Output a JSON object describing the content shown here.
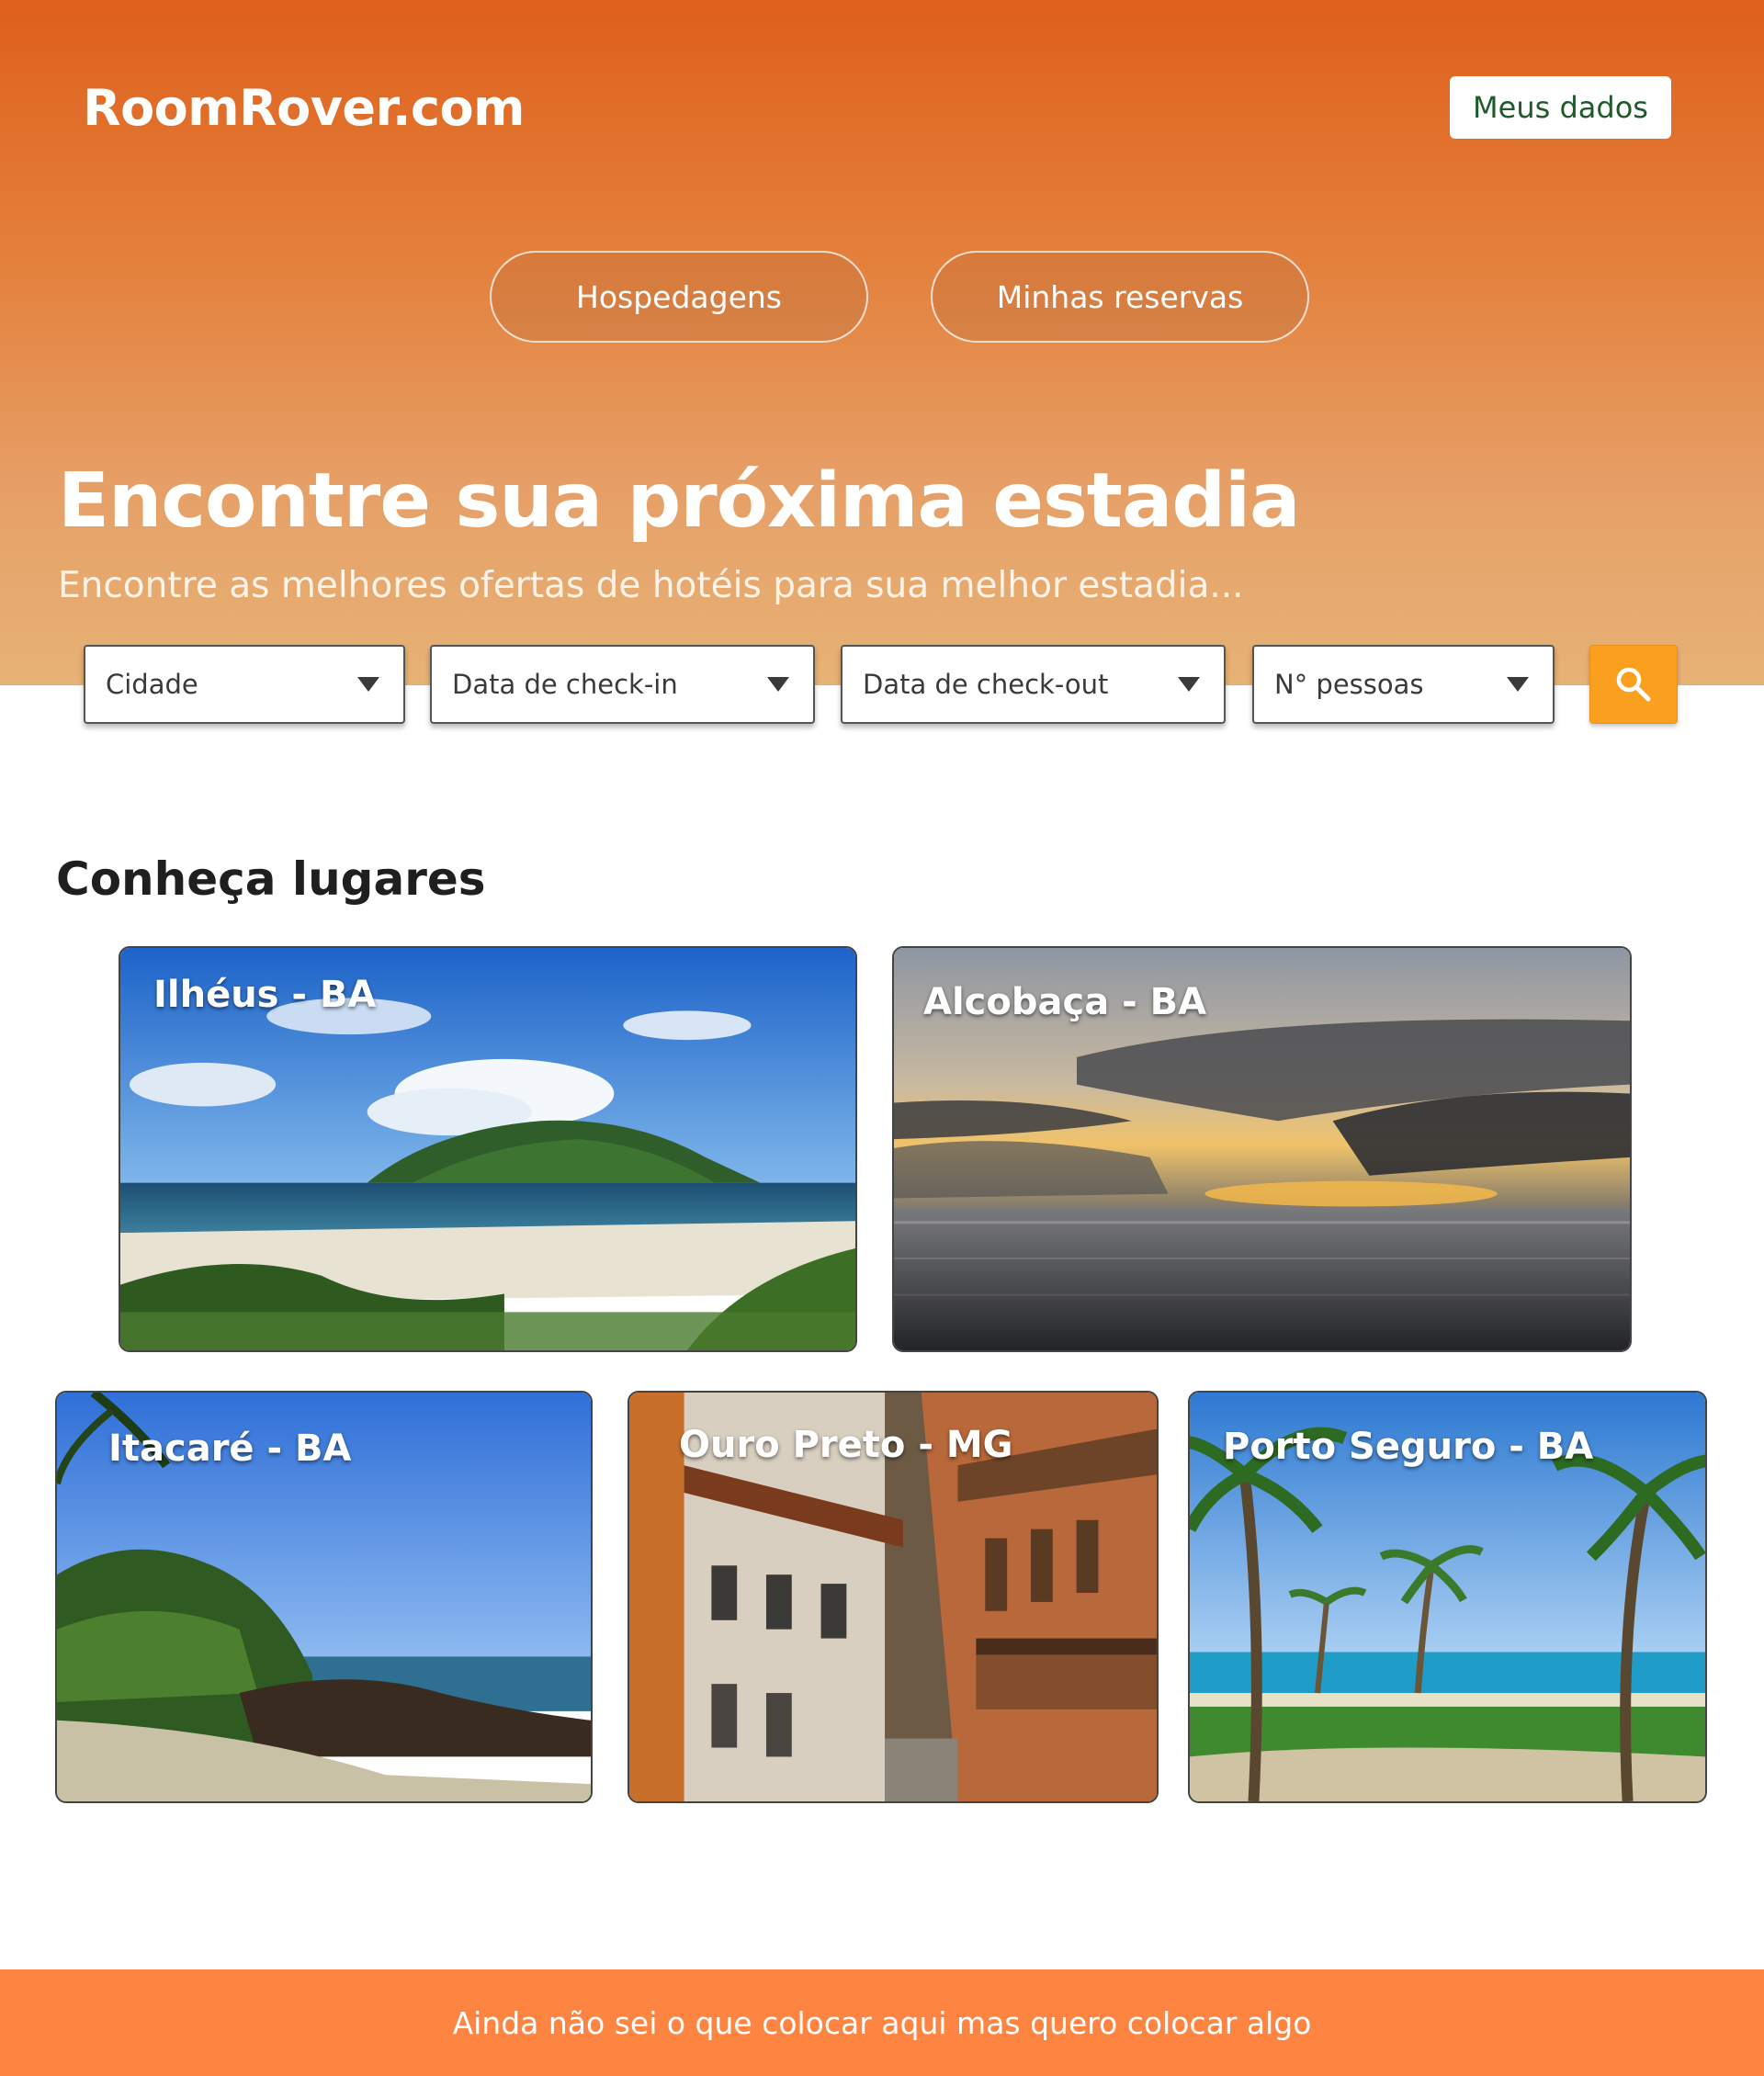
{
  "header": {
    "brand": "RoomRover.com",
    "profile_button": "Meus dados"
  },
  "nav": {
    "items": [
      {
        "label": "Hospedagens"
      },
      {
        "label": "Minhas reservas"
      }
    ]
  },
  "hero": {
    "title": "Encontre sua próxima estadia",
    "subtitle": "Encontre as melhores ofertas de hotéis para sua melhor estadia..."
  },
  "search": {
    "city": "Cidade",
    "checkin": "Data de check-in",
    "checkout": "Data de check-out",
    "guests": "N° pessoas",
    "search_icon": "search-icon"
  },
  "places": {
    "title": "Conheça lugares",
    "items": [
      {
        "label": "Ilhéus - BA",
        "scene": "beach-island"
      },
      {
        "label": "Alcobaça - BA",
        "scene": "sunset-sea"
      },
      {
        "label": "Itacaré - BA",
        "scene": "rocky-shore"
      },
      {
        "label": "Ouro Preto - MG",
        "scene": "colonial-street"
      },
      {
        "label": "Porto Seguro - BA",
        "scene": "palm-beach"
      }
    ]
  },
  "footer": {
    "text": "Ainda não sei o que colocar aqui mas quero colocar algo"
  },
  "colors": {
    "brand_orange": "#de601b",
    "search_button": "#fba01e",
    "footer": "#fd8441",
    "profile_text": "#1f5a2a"
  }
}
